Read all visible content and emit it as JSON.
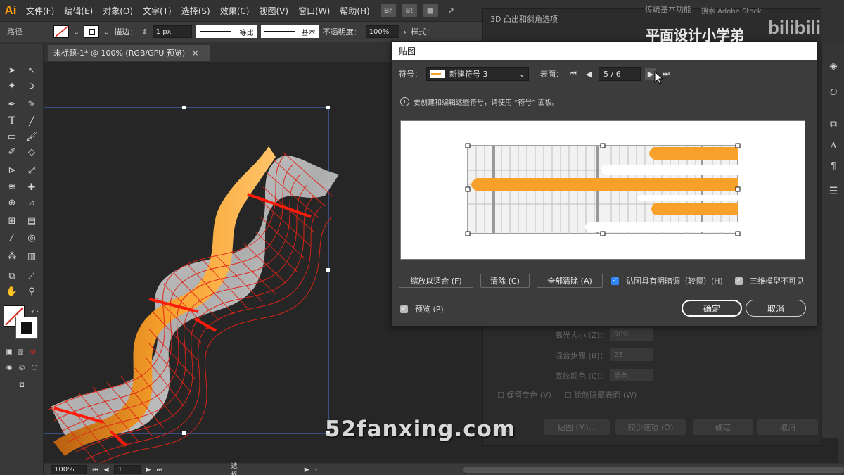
{
  "app": {
    "logo": "Ai"
  },
  "menubar": {
    "items": [
      "文件(F)",
      "编辑(E)",
      "对象(O)",
      "文字(T)",
      "选择(S)",
      "效果(C)",
      "视图(V)",
      "窗口(W)",
      "帮助(H)"
    ],
    "icons": [
      "Br",
      "St"
    ]
  },
  "control": {
    "path_label": "路径",
    "stroke_label": "描边：",
    "stroke_value": "1 px",
    "profile_value": "等比",
    "brush_value": "基本",
    "opacity_label": "不透明度：",
    "opacity_value": "100%",
    "style_label": "样式："
  },
  "document": {
    "tab_title": "未标题-1* @ 100% (RGB/GPU 预览)",
    "close_glyph": "×"
  },
  "status": {
    "zoom": "100%",
    "page": "1",
    "mode": "选择"
  },
  "bg_dialog": {
    "title": "3D 凸出和斜角选项",
    "top_right_fragment": "传统基本功能",
    "search_fragment": "搜索 Adobe Stock",
    "highlight_label": "高光大小 (Z)：",
    "highlight_value": "90%",
    "blend_label": "混合步骤 (B)：",
    "blend_value": "25",
    "shade_label": "底纹颜色 (C)：",
    "shade_value": "黑色",
    "keep_spot": "保留专色 (V)",
    "draw_hidden": "绘制隐藏表面 (W)",
    "preview_fragment": "预览",
    "map_button": "贴图 (M)...",
    "fewer_button": "较少选项 (O)",
    "ok": "确定",
    "cancel": "取消"
  },
  "map_dialog": {
    "title": "贴图",
    "symbol_label": "符号：",
    "symbol_value": "新建符号 3",
    "surface_label": "表面：",
    "surface_value": "5 / 6",
    "info_text": "要创建和编辑这些符号，请使用 “符号” 面板。",
    "scale_fit": "缩放以适合 (F)",
    "clear": "清除 (C)",
    "clear_all": "全部清除 (A)",
    "shade_artwork": "贴图具有明暗调（较慢）(H)",
    "invisible_geometry": "三维模型不可见",
    "preview": "预览 (P)",
    "ok": "确定",
    "cancel": "取消"
  },
  "overlay": {
    "channel": "平面设计小学弟",
    "bili": "bilibili",
    "watermark": "52fanxing.com"
  },
  "colors": {
    "accent_orange": "#f7a12b",
    "wire_red": "#e02418",
    "selection_blue": "#4a7be0",
    "check_blue": "#2f86ff"
  }
}
